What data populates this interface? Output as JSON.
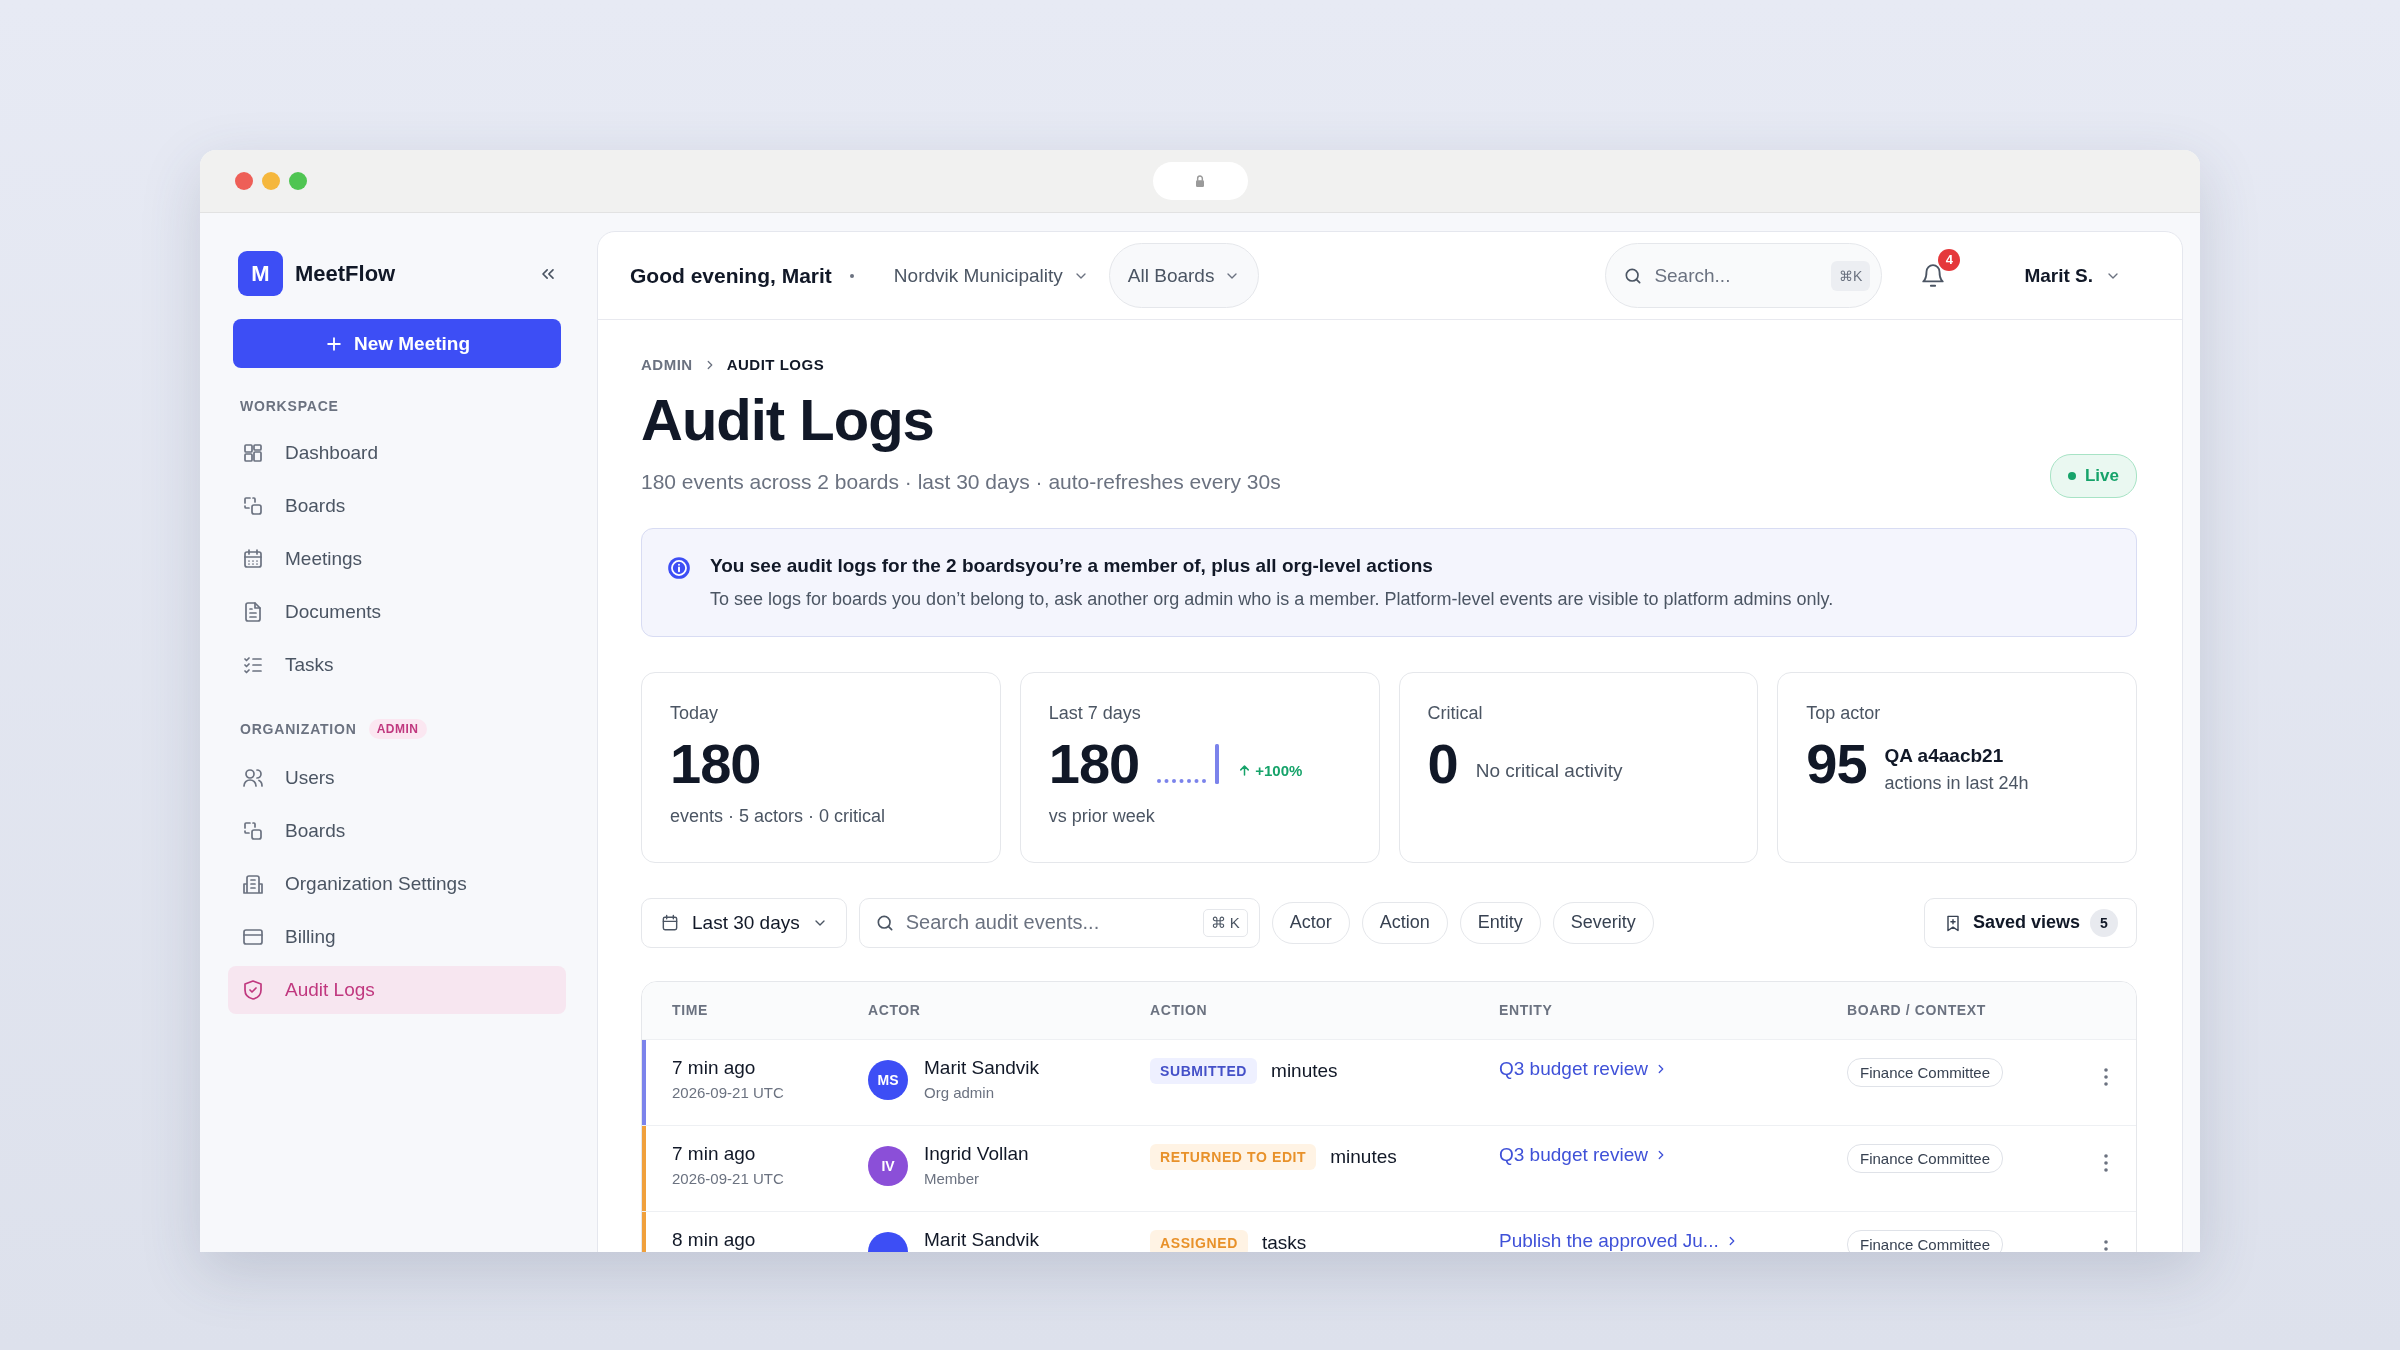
{
  "sidebar": {
    "logo_letter": "M",
    "brand": "MeetFlow",
    "new_button": "New Meeting",
    "sections": [
      {
        "label": "WORKSPACE",
        "items": [
          {
            "label": "Dashboard",
            "selected": false
          },
          {
            "label": "Boards",
            "selected": false
          },
          {
            "label": "Meetings",
            "selected": false
          },
          {
            "label": "Documents",
            "selected": false
          },
          {
            "label": "Tasks",
            "selected": false
          }
        ]
      },
      {
        "label": "ORGANIZATION",
        "badge": "ADMIN",
        "items": [
          {
            "label": "Users",
            "selected": false
          },
          {
            "label": "Boards",
            "selected": false
          },
          {
            "label": "Organization Settings",
            "selected": false
          },
          {
            "label": "Billing",
            "selected": false
          },
          {
            "label": "Audit Logs",
            "selected": true
          }
        ]
      }
    ]
  },
  "topbar": {
    "greeting": "Good evening, Marit",
    "organization": "Nordvik Municipality",
    "boards": "All Boards",
    "search_placeholder": "Search...",
    "search_shortcut": "⌘K",
    "notifications": "4",
    "user": "Marit S."
  },
  "page": {
    "breadcrumb": [
      "ADMIN",
      "AUDIT LOGS"
    ],
    "title": "Audit Logs",
    "subtitle": "180 events across 2 boards · last 30 days · auto-refreshes every 30s",
    "status": "Live"
  },
  "info": {
    "title": "You see audit logs for the 2 boardsyou’re a member of, plus all org-level actions",
    "text": "To see logs for boards you don’t belong to, ask another org admin who is a member. Platform-level events are visible to platform admins only."
  },
  "stats": [
    {
      "kind": "plain",
      "label": "Today",
      "value": "180",
      "note": "events · 5 actors · 0 critical"
    },
    {
      "kind": "trend",
      "label": "Last 7 days",
      "value": "180",
      "trend": "+100%",
      "note": "vs prior week"
    },
    {
      "kind": "inline",
      "label": "Critical",
      "value": "0",
      "note": "No critical activity"
    },
    {
      "kind": "actor",
      "label": "Top actor",
      "value": "95",
      "actor": "QA a4aacb21",
      "note": "actions in last 24h"
    }
  ],
  "filters": {
    "date_range": "Last 30 days",
    "search_placeholder": "Search audit events...",
    "search_shortcut": "⌘ K",
    "chips": [
      "Actor",
      "Action",
      "Entity",
      "Severity"
    ],
    "saved_views": "Saved views",
    "saved_count": "5"
  },
  "table": {
    "columns": [
      "TIME",
      "ACTOR",
      "ACTION",
      "ENTITY",
      "BOARD / CONTEXT"
    ],
    "rows": [
      {
        "color": "#7b83eb",
        "time": "7 min ago",
        "date": "2026-09-21 UTC",
        "actor": {
          "initials": "MS",
          "name": "Marit Sandvik",
          "role": "Org admin",
          "color": "#3d4ef5"
        },
        "action": {
          "kind": "submitted",
          "label": "SUBMITTED",
          "object": "minutes"
        },
        "entity": "Q3 budget review",
        "board": "Finance Committee"
      },
      {
        "color": "#f0a03c",
        "time": "7 min ago",
        "date": "2026-09-21 UTC",
        "actor": {
          "initials": "IV",
          "name": "Ingrid Vollan",
          "role": "Member",
          "color": "#8b4fd8"
        },
        "action": {
          "kind": "returned",
          "label": "RETURNED TO EDIT",
          "object": "minutes"
        },
        "entity": "Q3 budget review",
        "board": "Finance Committee"
      },
      {
        "color": "#f0a03c",
        "time": "8 min ago",
        "actor": {
          "name": "Marit Sandvik",
          "color": "#3d4ef5"
        },
        "action": {
          "kind": "assigned",
          "label": "ASSIGNED",
          "object": "tasks"
        },
        "entity": "Publish the approved Ju...",
        "board": "Finance Committee"
      }
    ]
  }
}
